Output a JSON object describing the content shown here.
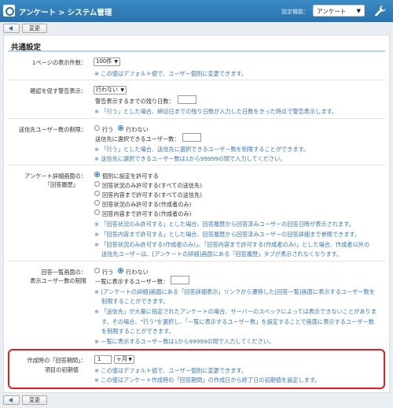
{
  "header": {
    "title": "アンケート > システム管理",
    "settings_label": "設定機能：",
    "settings_value": "アンケート"
  },
  "toolbar": {
    "change_label": "変更"
  },
  "page": {
    "heading": "共通設定"
  },
  "display_count": {
    "label": "1ページの表示件数：",
    "value": "100件",
    "note": "※ この値はデフォルト値で、ユーザー個別に変更できます。"
  },
  "warning": {
    "label": "確認を促す警告表示：",
    "value": "行わない",
    "days_label": "警告表示するまでの残り日数：",
    "days_value": "",
    "note": "※ 「行う」とした場合、締切日までの残り日数が入力した日数をきった時点で警告表示します。"
  },
  "recipients": {
    "label": "送信先ユーザー数の制限：",
    "option_yes": "行う",
    "option_no": "行わない",
    "selected": "行わない",
    "count_label": "送信先に選択できるユーザー数：",
    "count_value": "",
    "note1": "※ 「行う」とした場合、送信先に選択できるユーザー数を制限することができます。",
    "note2": "※ 送信先に選択できるユーザー数は1から99999の間で入力してください。"
  },
  "detail_screen": {
    "label1": "アンケート詳細画面の：",
    "label2": "「回答履歴」",
    "options": [
      "個別に設定を許可する",
      "回答状況のみ許可する(すべての送信先)",
      "回答内容まで許可する(すべての送信先)",
      "回答状況のみ許可する(作成者のみ)",
      "回答内容まで許可する(作成者のみ)"
    ],
    "selected_index": 0,
    "notes": [
      "※ 「回答状況のみ許可する」とした場合、回答履歴から回答済みユーザーの回答日時が表示されます。",
      "※ 「回答内容まで許可する」とした場合、回答履歴から回答済みユーザーの回答詳細まで参照できます。",
      "※ 「回答状況のみ許可する(作成者のみ)」、「回答内容まで許可する(作成者のみ)」とした場合、作成者以外の",
      "送信先ユーザーは、[アンケートの詳細]画面にある「回答履歴」タブが表示されなくなります。"
    ]
  },
  "list_screen": {
    "label1": "回答一覧画面の：",
    "label2": "表示ユーザー数の制限",
    "option_yes": "行う",
    "option_no": "行わない",
    "selected": "行わない",
    "count_label": "一覧に表示するユーザー数：",
    "count_value": "",
    "notes": [
      "※ [アンケートの詳細]画面にある「回答詳細表示」リンクから遷移した[回答一覧]画面に表示するユーザー数を",
      "制限することができます。",
      "※ 「送信先」が大量に指定されたアンケートの場合、サーバーのスペックによっては表示できないことがありま",
      "す。その場合、\"行う\"を選択し、「一覧に表示するユーザー数」を設定することで画面に表示するユーザー数",
      "を制限することができます。",
      "※ 一覧に表示するユーザー数は1から99999の間で入力してください。"
    ]
  },
  "answer_period": {
    "label1": "作成時の「回答期間」：",
    "label2": "項目の初期値",
    "number_value": "1",
    "unit_value": "ヶ月",
    "note1": "※ この値はデフォルト値で、ユーザー個別に変更できます。",
    "note2": "※ この値はアンケート作成時の「回答期間」の作成日から終了日の初期値を設定します。"
  },
  "colors": {
    "header_bg": "#2a72ad",
    "note_text": "#3a78b5",
    "highlight_border": "#e02020"
  },
  "icons": [
    "app-icon",
    "wrench-icon",
    "back-arrow-icon",
    "select-caret-icon"
  ]
}
